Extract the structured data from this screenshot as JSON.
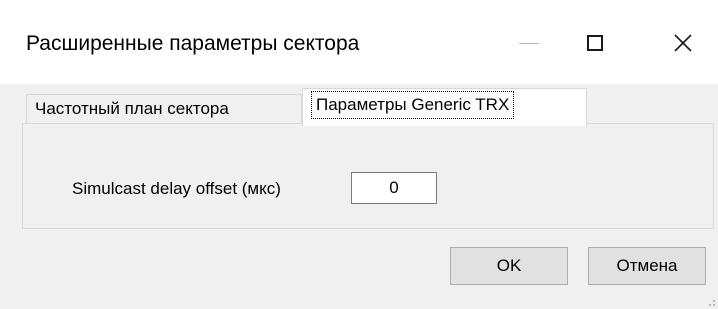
{
  "window": {
    "title": "Расширенные параметры сектора"
  },
  "caption_buttons": {
    "minimize": "minimize-icon",
    "maximize": "maximize-icon",
    "close": "close-icon"
  },
  "tabs": [
    {
      "label": "Частотный план сектора",
      "active": false
    },
    {
      "label": "Параметры Generic TRX",
      "active": true
    }
  ],
  "panel": {
    "delay_label": "Simulcast delay offset (мкс)",
    "delay_value": "0"
  },
  "buttons": {
    "ok_label": "OK",
    "cancel_label": "Отмена"
  }
}
